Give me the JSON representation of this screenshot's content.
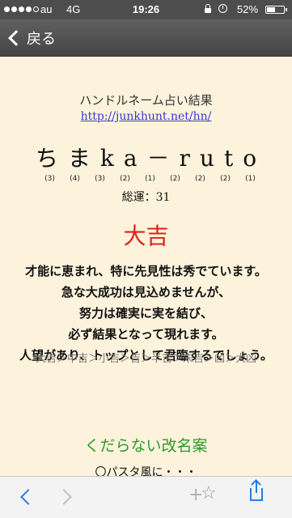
{
  "status_bar": {
    "carrier": "au",
    "network": "4G",
    "time": "19:26",
    "battery": "52%",
    "battery_level": 0.52,
    "signal_bars": 4,
    "signal_total": 5
  },
  "nav": {
    "back_label": "戻る"
  },
  "result": {
    "heading": "ハンドルネーム占い結果",
    "url": "http://junkhunt.net/hn/",
    "nickname": "ちまka－ruto",
    "strokes": [
      "(3)",
      "(4)",
      "(3)",
      "(2)",
      "(1)",
      "(2)",
      "(2)",
      "(2)",
      "(1)"
    ],
    "total": "総運：31",
    "verdict": "大吉",
    "description": [
      "才能に恵まれ、特に先見性は秀でています。",
      "急な大成功は見込めませんが、",
      "努力は確実に実を結び、",
      "必ず結果となって現れます。",
      "人望があり、トップとして君臨するでしょう。"
    ],
    "ranking": "大吉＞中吉＞小吉＞吉＞半吉＞末吉＞凶＞大凶",
    "section_title": "くだらない改名案",
    "suggestion": "〇パスタ風に・・・"
  },
  "toolbar": {
    "back": "back-icon",
    "forward": "forward-icon",
    "add": "+",
    "bookmark": "☆",
    "share": "share-icon"
  },
  "colors": {
    "page_bg": "#fdf3dc",
    "verdict": "#e0201a",
    "section": "#2a9a2a",
    "link": "#3a3ad0",
    "toolbar_accent": "#2a7de1"
  }
}
